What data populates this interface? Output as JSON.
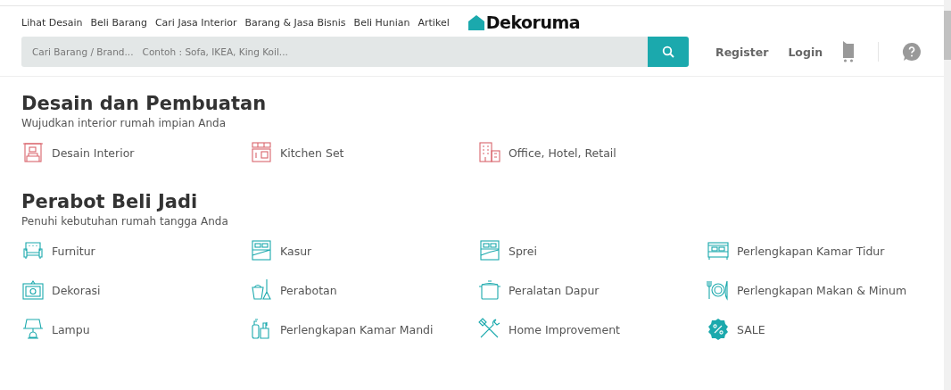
{
  "nav": {
    "links": [
      "Lihat Desain",
      "Beli Barang",
      "Cari Jasa Interior",
      "Barang & Jasa Bisnis",
      "Beli Hunian",
      "Artikel"
    ],
    "logo": "Dekoruma"
  },
  "search": {
    "placeholder": "Cari Barang / Brand...   Contoh : Sofa, IKEA, King Koil..."
  },
  "account": [
    "Register",
    "Login"
  ],
  "sections": [
    {
      "title": "Desain dan Pembuatan",
      "subtitle": "Wujudkan interior rumah impian Anda",
      "items": [
        "Desain Interior",
        "Kitchen Set",
        "Office, Hotel, Retail"
      ]
    },
    {
      "title": "Perabot Beli Jadi",
      "subtitle": "Penuhi kebutuhan rumah tangga Anda",
      "items": [
        "Furnitur",
        "Kasur",
        "Sprei",
        "Perlengkapan Kamar Tidur",
        "Dekorasi",
        "Perabotan",
        "Peralatan Dapur",
        "Perlengkapan Makan & Minum",
        "Lampu",
        "Perlengkapan Kamar Mandi",
        "Home Improvement",
        "SALE"
      ]
    }
  ]
}
